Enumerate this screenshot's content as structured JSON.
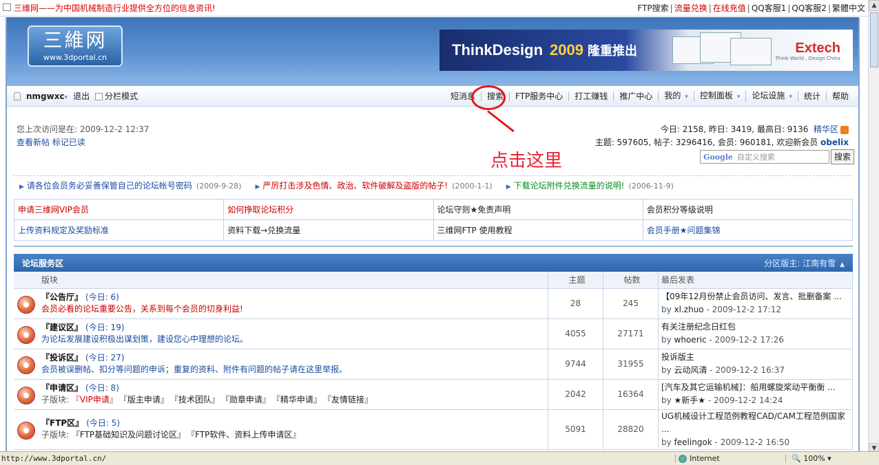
{
  "topbar": {
    "slogan": "三维网——为中国机械制造行业提供全方位的信息资讯!",
    "links": [
      {
        "label": "FTP搜索",
        "red": false
      },
      {
        "label": "流量兑换",
        "red": true
      },
      {
        "label": "在线充值",
        "red": true
      },
      {
        "label": "QQ客服1",
        "red": false
      },
      {
        "label": "QQ客服2",
        "red": false
      },
      {
        "label": "繁體中文",
        "red": false
      }
    ]
  },
  "header": {
    "logo_cn": "三維网",
    "logo_url": "www.3dportal.cn",
    "banner_t1": "ThinkDesign",
    "banner_t2": "2009",
    "banner_t3": "隆重推出",
    "banner_brand": "Extech",
    "banner_brand_sub": "Think World , Design China"
  },
  "nav": {
    "username": "nmgwxc",
    "logout": "退出",
    "split_mode": "分栏模式",
    "items": [
      {
        "label": "短消息",
        "dropdown": false
      },
      {
        "label": "搜索",
        "dropdown": false
      },
      {
        "label": "FTP服务中心",
        "dropdown": false
      },
      {
        "label": "打工赚钱",
        "dropdown": false
      },
      {
        "label": "推广中心",
        "dropdown": false
      },
      {
        "label": "我的",
        "dropdown": true
      },
      {
        "label": "控制面板",
        "dropdown": true
      },
      {
        "label": "论坛设施",
        "dropdown": true
      },
      {
        "label": "统计",
        "dropdown": false
      },
      {
        "label": "帮助",
        "dropdown": false
      }
    ]
  },
  "info": {
    "last_visit": "您上次访问是在: 2009-12-2 12:37",
    "new_posts": "查看新帖",
    "mark_read": "标记已读",
    "stats_line1": "今日: 2158, 昨日: 3419, 最高日: 9136",
    "digest": "精华区",
    "stats_line2": "主题: 597605, 帖子: 3296416, 会员: 960181, 欢迎新会员",
    "newest_member": "obelix",
    "search_placeholder": "自定义搜索",
    "search_brand": "Google",
    "search_button": "搜索",
    "annotation": "点击这里"
  },
  "announcements": [
    {
      "text": "请各位会员务必妥善保管自己的论坛帐号密码",
      "date": "(2009-9-28)",
      "color": "c1"
    },
    {
      "text": "严厉打击涉及色情、政治、软件破解及盗版的帖子!",
      "date": "(2000-1-1)",
      "color": "c2"
    },
    {
      "text": "下载论坛附件兑换流量的说明!",
      "date": "(2006-11-9)",
      "color": "c3"
    }
  ],
  "quicklinks": [
    [
      {
        "label": "申请三维网VIP会员",
        "color": "#c00"
      },
      {
        "label": "如何挣取论坛积分",
        "color": "#c00"
      },
      {
        "label": "论坛守则★免责声明",
        "color": "#222"
      },
      {
        "label": "会员积分等级说明",
        "color": "#222"
      }
    ],
    [
      {
        "label": "上传资料规定及奖励标准",
        "color": "#1a4ba0"
      },
      {
        "label": "资料下载→兑换流量",
        "color": "#222"
      },
      {
        "label": "三维网FTP 使用教程",
        "color": "#222"
      },
      {
        "label": "会员手册★问题集锦",
        "color": "#1a4ba0"
      }
    ]
  ],
  "forum": {
    "section_title": "论坛服务区",
    "moderator": "分区版主: 江南有雪",
    "columns": {
      "board": "版块",
      "topics": "主题",
      "posts": "帖数",
      "last": "最后发表"
    },
    "rows": [
      {
        "name": "『公告厅』",
        "today": "(今日: 6)",
        "desc": "会员必看的论坛重要公告，关系到每个会员的切身利益!",
        "desc_color": "red",
        "subs": [],
        "topics": "28",
        "posts": "245",
        "last_title": "【09年12月份禁止会员访问、发言、批删备案 ...",
        "last_by": "xl.zhuo",
        "last_time": "- 2009-12-2 17:12"
      },
      {
        "name": "『建议区』",
        "today": "(今日: 19)",
        "desc": "为论坛发展建设积极出谋划策，建设您心中理想的论坛。",
        "desc_color": "blue",
        "subs": [],
        "topics": "4055",
        "posts": "27171",
        "last_title": "有关注册纪念日红包",
        "last_by": "whoeric",
        "last_time": "- 2009-12-2 17:26"
      },
      {
        "name": "『投诉区』",
        "today": "(今日: 27)",
        "desc": "会员被误删帖、扣分等问题的申诉；重复的资料、附件有问题的帖子请在这里举报。",
        "desc_color": "blue",
        "subs": [],
        "topics": "9744",
        "posts": "31955",
        "last_title": "投诉版主",
        "last_by": "云动风清",
        "last_time": "- 2009-12-2 16:37"
      },
      {
        "name": "『申请区』",
        "today": "(今日: 8)",
        "desc": "",
        "desc_color": "blue",
        "sub_label": "子版块:",
        "subs": [
          {
            "label": "『VIP申请』",
            "red": true
          },
          {
            "label": "『版主申请』",
            "red": false
          },
          {
            "label": "『技术团队』",
            "red": false
          },
          {
            "label": "『勋章申请』",
            "red": false
          },
          {
            "label": "『精华申请』",
            "red": false
          },
          {
            "label": "『友情链接』",
            "red": false
          }
        ],
        "topics": "2042",
        "posts": "16364",
        "last_title": "[汽车及其它运输机械]：船用螺旋桨动平衡衡 ...",
        "last_by": "★新手★",
        "last_time": "- 2009-12-2 14:24"
      },
      {
        "name": "『FTP区』",
        "today": "(今日: 5)",
        "desc": "",
        "desc_color": "blue",
        "sub_label": "子版块:",
        "subs": [
          {
            "label": "『FTP基础知识及问题讨论区』",
            "red": false
          },
          {
            "label": "『FTP软件、资料上传申请区』",
            "red": false
          }
        ],
        "topics": "5091",
        "posts": "28820",
        "last_title": "UG机械设计工程范例教程CAD/CAM工程范例国家 ...",
        "last_by": "feelingok",
        "last_time": "- 2009-12-2 16:50"
      }
    ]
  },
  "statusbar": {
    "url": "http://www.3dportal.cn/",
    "zone": "Internet",
    "zoom": "100%"
  }
}
